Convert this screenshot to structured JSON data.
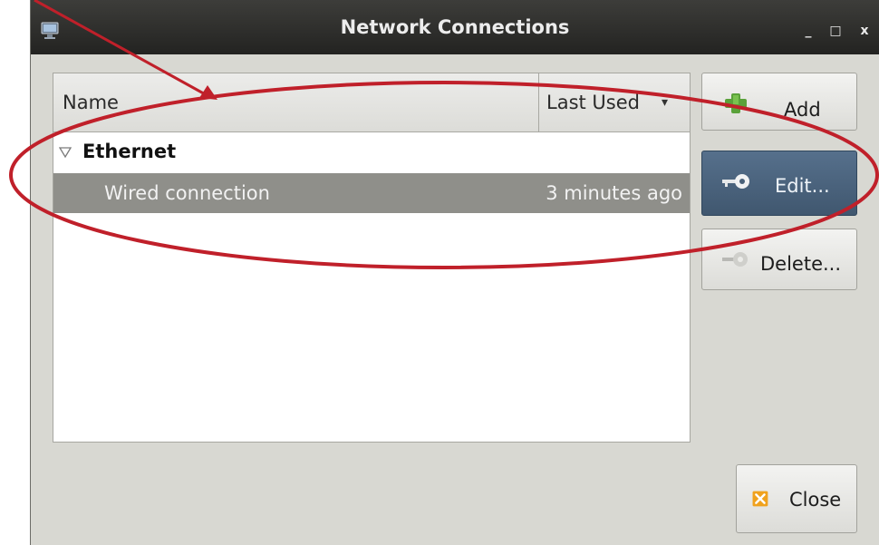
{
  "window": {
    "title": "Network Connections",
    "minimize_symbol": "_",
    "maximize_symbol": "□",
    "close_symbol": "x"
  },
  "table": {
    "columns": [
      "Name",
      "Last Used"
    ],
    "sort_indicator": "▾",
    "groups": [
      {
        "label": "Ethernet",
        "connections": [
          {
            "name": "Wired connection",
            "last_used": "3 minutes ago"
          }
        ]
      }
    ]
  },
  "buttons": {
    "add": "Add",
    "edit": "Edit...",
    "delete": "Delete...",
    "close": "Close"
  },
  "icons": {
    "app": "network-icon",
    "add": "plus-icon",
    "edit": "key-icon",
    "delete": "key-icon",
    "close": "close-icon"
  },
  "colors": {
    "annotation": "#c0202a",
    "selected_row": "#8f8f8a",
    "edit_button": "#4a6179"
  }
}
